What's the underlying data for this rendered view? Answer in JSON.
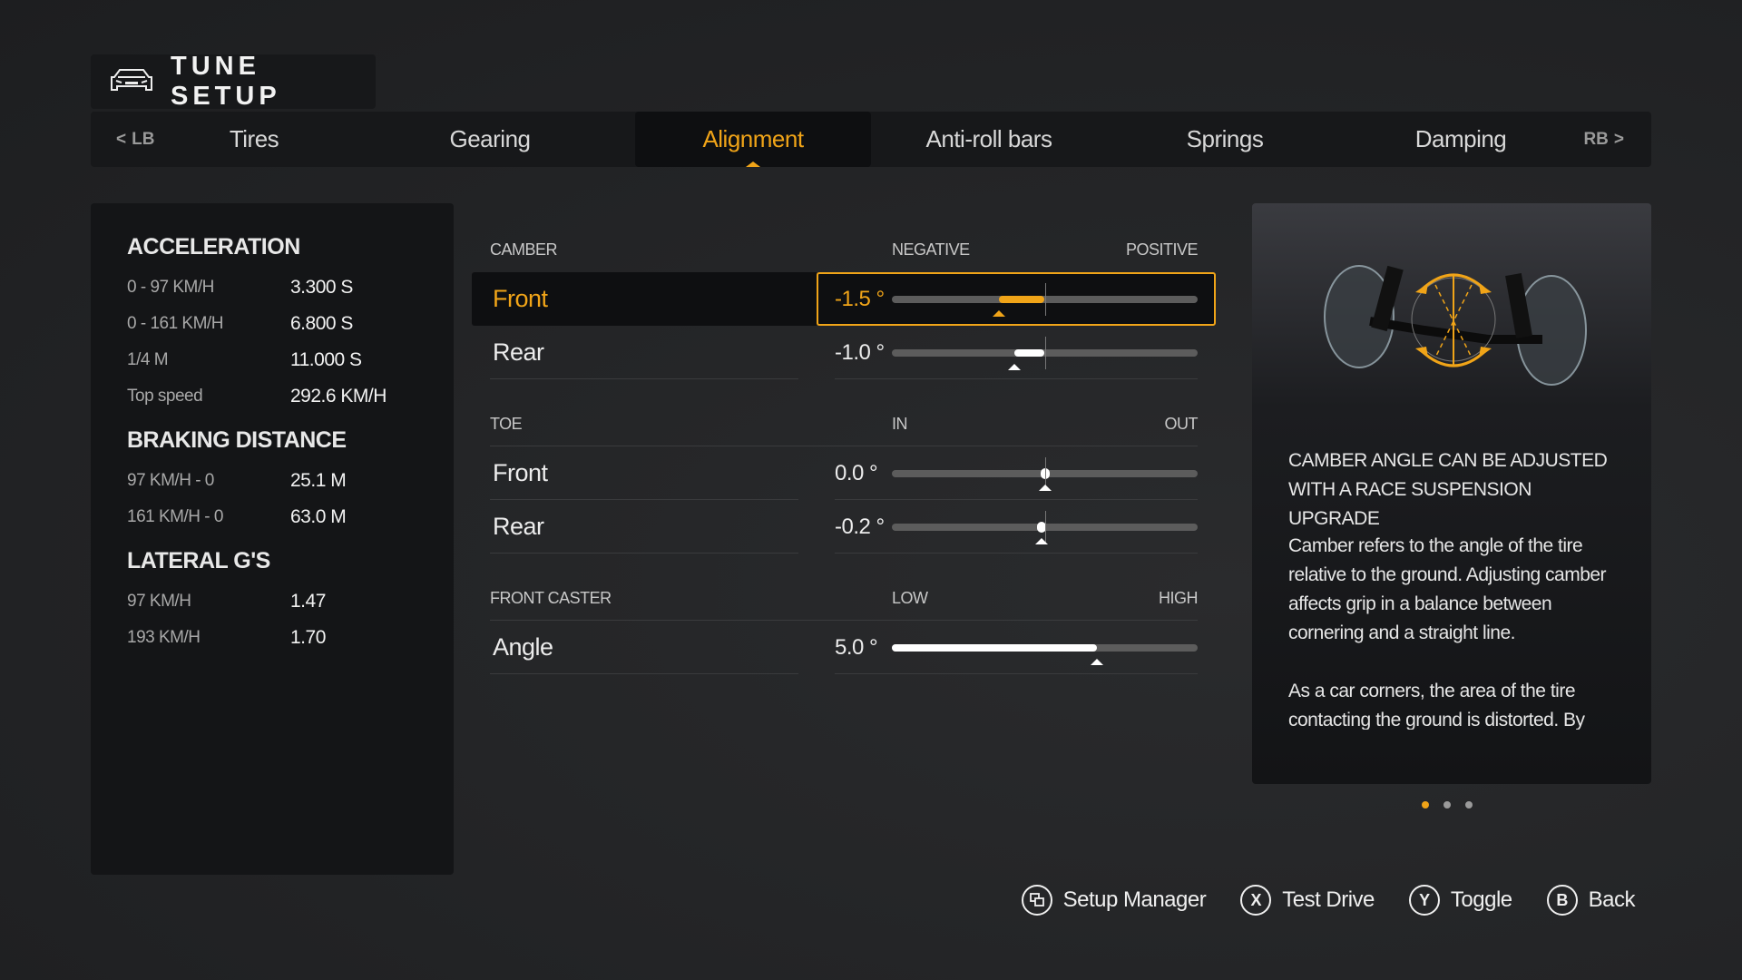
{
  "header": {
    "title": "TUNE SETUP",
    "icon": "car-front-icon"
  },
  "tabs": {
    "prev_bumper": "LB",
    "next_bumper": "RB",
    "items": [
      {
        "label": "Tires",
        "active": false
      },
      {
        "label": "Gearing",
        "active": false
      },
      {
        "label": "Alignment",
        "active": true
      },
      {
        "label": "Anti-roll bars",
        "active": false
      },
      {
        "label": "Springs",
        "active": false
      },
      {
        "label": "Damping",
        "active": false
      }
    ]
  },
  "stats": {
    "acceleration": {
      "title": "ACCELERATION",
      "rows": [
        {
          "label": "0 - 97 KM/H",
          "value": "3.300 S"
        },
        {
          "label": "0 - 161 KM/H",
          "value": "6.800 S"
        },
        {
          "label": "1/4 M",
          "value": "11.000 S"
        },
        {
          "label": "Top speed",
          "value": "292.6 KM/H"
        }
      ]
    },
    "braking": {
      "title": "BRAKING DISTANCE",
      "rows": [
        {
          "label": "97 KM/H - 0",
          "value": "25.1 M"
        },
        {
          "label": "161 KM/H - 0",
          "value": "63.0 M"
        }
      ]
    },
    "lateral": {
      "title": "LATERAL G'S",
      "rows": [
        {
          "label": "97 KM/H",
          "value": "1.47"
        },
        {
          "label": "193 KM/H",
          "value": "1.70"
        }
      ]
    }
  },
  "settings": {
    "camber": {
      "title": "CAMBER",
      "low": "NEGATIVE",
      "high": "POSITIVE",
      "rows": [
        {
          "name": "Front",
          "value": "-1.5 °",
          "fraction": 0.35,
          "selected": true
        },
        {
          "name": "Rear",
          "value": "-1.0 °",
          "fraction": 0.4,
          "selected": false
        }
      ]
    },
    "toe": {
      "title": "TOE",
      "low": "IN",
      "high": "OUT",
      "rows": [
        {
          "name": "Front",
          "value": "0.0 °",
          "fraction": 0.5
        },
        {
          "name": "Rear",
          "value": "-0.2 °",
          "fraction": 0.49
        }
      ]
    },
    "caster": {
      "title": "FRONT CASTER",
      "low": "LOW",
      "high": "HIGH",
      "rows": [
        {
          "name": "Angle",
          "value": "5.0 °",
          "fraction": 0.67
        }
      ]
    }
  },
  "info": {
    "title": "CAMBER ANGLE CAN BE ADJUSTED WITH A RACE SUSPENSION UPGRADE",
    "paragraphs": [
      "Camber refers to the angle of the tire relative to the ground. Adjusting camber affects grip in a balance between cornering and a straight line.",
      "As a car corners, the area of the tire contacting the ground is distorted. By adjusting camber, drivers can correct"
    ],
    "page": 1,
    "pages": 3,
    "accent": "#f0a418"
  },
  "footer": [
    {
      "glyph": "view-icon",
      "label": "Setup Manager"
    },
    {
      "glyph": "X",
      "label": "Test Drive"
    },
    {
      "glyph": "Y",
      "label": "Toggle"
    },
    {
      "glyph": "B",
      "label": "Back"
    }
  ]
}
